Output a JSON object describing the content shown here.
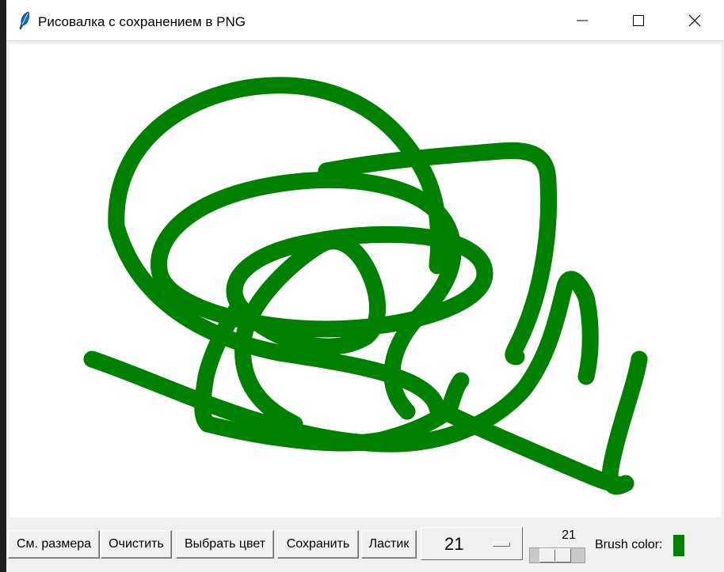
{
  "window": {
    "title": "Рисовалка с сохранением в PNG"
  },
  "titlebar": {
    "minimize_icon": "minimize-icon",
    "maximize_icon": "maximize-icon",
    "close_icon": "close-icon",
    "app_icon": "feather-icon"
  },
  "canvas": {
    "stroke_color": "#008000",
    "background": "#ffffff"
  },
  "toolbar": {
    "buttons": [
      "См. размера",
      "Очистить",
      "Выбрать цвет",
      "Сохранить",
      "Ластик"
    ],
    "size_option": "21",
    "scale": {
      "value": "21",
      "min": 1,
      "max": 50,
      "level": 0.42
    },
    "brush_label": "Brush color:",
    "brush_color": "#008000"
  }
}
